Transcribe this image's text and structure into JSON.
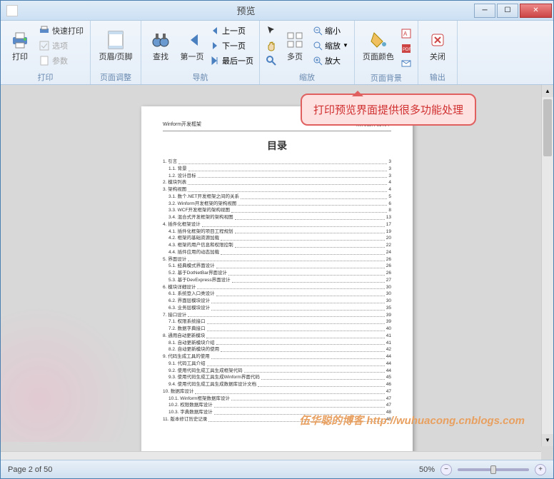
{
  "window": {
    "title": "预览"
  },
  "ribbon": {
    "groups": {
      "print": {
        "label": "打印",
        "print_btn": "打印",
        "quick_print": "快速打印",
        "options": "选项",
        "params": "参数"
      },
      "page_setup": {
        "label": "页面调整",
        "header_footer": "页眉/页脚"
      },
      "nav": {
        "label": "导航",
        "find": "查找",
        "first_page": "第一页",
        "prev_page": "上一页",
        "next_page": "下一页",
        "last_page": "最后一页"
      },
      "zoom": {
        "label": "缩放",
        "multi_page": "多页",
        "zoom_out": "缩小",
        "zoom": "缩放",
        "zoom_in": "放大"
      },
      "bg": {
        "label": "页面背景",
        "page_color": "页面颜色"
      },
      "output": {
        "label": "输出",
        "close": "关闭"
      }
    }
  },
  "balloon": "打印预览界面提供很多功能处理",
  "watermark": "伍华聪的博客 http://wuhuacong.cnblogs.com",
  "document": {
    "header_left": "Winform开发框架",
    "header_right": "架构设计说明书",
    "title": "目录",
    "toc": [
      {
        "l": 0,
        "t": "1. 引言",
        "p": "3"
      },
      {
        "l": 1,
        "t": "1.1. 背景",
        "p": "3"
      },
      {
        "l": 1,
        "t": "1.2. 设计目标",
        "p": "3"
      },
      {
        "l": 0,
        "t": "2. 模块列表",
        "p": "4"
      },
      {
        "l": 0,
        "t": "3. 架构视图",
        "p": "4"
      },
      {
        "l": 1,
        "t": "3.1. 数个.NET开发框架之间的关系",
        "p": "5"
      },
      {
        "l": 1,
        "t": "3.2. Winform开发框架的架构视图",
        "p": "6"
      },
      {
        "l": 1,
        "t": "3.3. WCF开发框架的架构视图",
        "p": "8"
      },
      {
        "l": 1,
        "t": "3.4. 混合式开发框架的架构视图",
        "p": "13"
      },
      {
        "l": 0,
        "t": "4. 插件化框架设计",
        "p": "17"
      },
      {
        "l": 1,
        "t": "4.1. 插件化框架的项目工程规划",
        "p": "19"
      },
      {
        "l": 1,
        "t": "4.2. 框架的基础资源加载",
        "p": "20"
      },
      {
        "l": 1,
        "t": "4.3. 框架的用户信息和权限控制",
        "p": "22"
      },
      {
        "l": 1,
        "t": "4.4. 插件应用的动态加载",
        "p": "24"
      },
      {
        "l": 0,
        "t": "5. 界面设计",
        "p": "26"
      },
      {
        "l": 1,
        "t": "5.1. 经典模式界面设计",
        "p": "26"
      },
      {
        "l": 1,
        "t": "5.2. 基于DotNetBar界面设计",
        "p": "26"
      },
      {
        "l": 1,
        "t": "5.3. 基于DevExpress界面设计",
        "p": "27"
      },
      {
        "l": 0,
        "t": "6. 模块详细设计",
        "p": "30"
      },
      {
        "l": 1,
        "t": "6.1. 系统登入口类设计",
        "p": "30"
      },
      {
        "l": 1,
        "t": "6.2. 界面层模块设计",
        "p": "30"
      },
      {
        "l": 1,
        "t": "6.3. 业务层模块设计",
        "p": "35"
      },
      {
        "l": 0,
        "t": "7. 接口设计",
        "p": "39"
      },
      {
        "l": 1,
        "t": "7.1. 权限系统接口",
        "p": "39"
      },
      {
        "l": 1,
        "t": "7.2. 数据字典接口",
        "p": "40"
      },
      {
        "l": 0,
        "t": "8. 通用自动更新模块",
        "p": "41"
      },
      {
        "l": 1,
        "t": "8.1. 自动更新模块介绍",
        "p": "41"
      },
      {
        "l": 1,
        "t": "8.2. 自动更新模块的使用",
        "p": "42"
      },
      {
        "l": 0,
        "t": "9. 代码生成工具的使用",
        "p": "44"
      },
      {
        "l": 1,
        "t": "9.1. 代码工具介绍",
        "p": "44"
      },
      {
        "l": 1,
        "t": "9.2. 使用代码生成工具生成框架代码",
        "p": "44"
      },
      {
        "l": 1,
        "t": "9.3. 使用代码生成工具生成Winform界面代码",
        "p": "45"
      },
      {
        "l": 1,
        "t": "9.4. 使用代码生成工具生成数据库设计文档",
        "p": "46"
      },
      {
        "l": 0,
        "t": "10. 数据库设计",
        "p": "47"
      },
      {
        "l": 1,
        "t": "10.1. Winform框架数据库设计",
        "p": "47"
      },
      {
        "l": 1,
        "t": "10.2. 权限数据库设计",
        "p": "47"
      },
      {
        "l": 1,
        "t": "10.3. 字典数据库设计",
        "p": "48"
      },
      {
        "l": 0,
        "t": "11. 版本修订历史记录",
        "p": "48"
      }
    ]
  },
  "statusbar": {
    "page_info": "Page 2 of 50",
    "zoom_pct": "50%"
  }
}
